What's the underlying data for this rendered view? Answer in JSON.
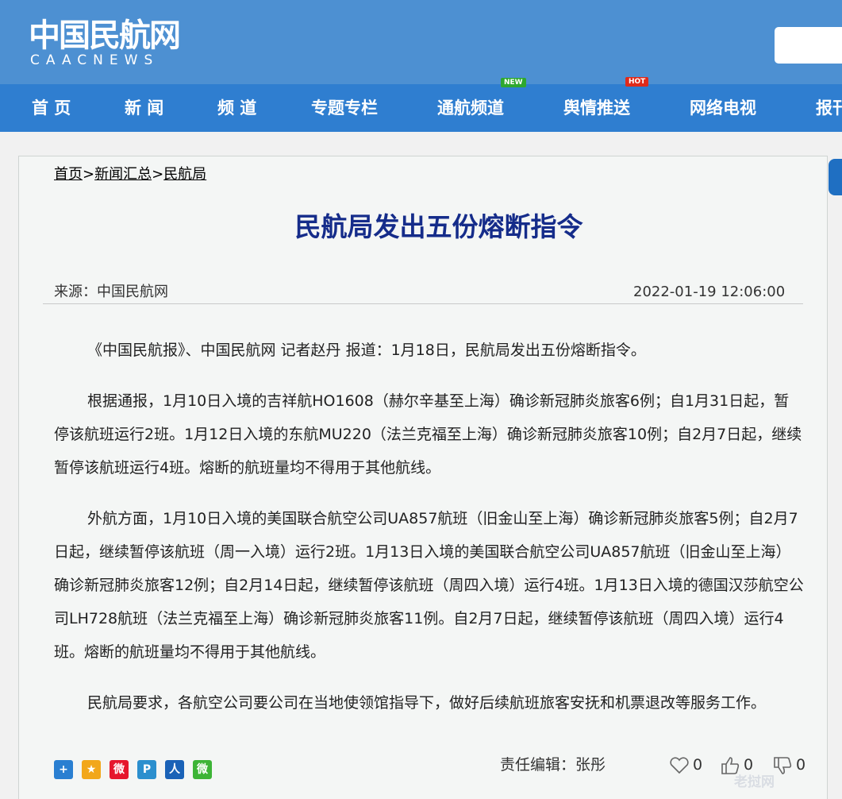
{
  "header": {
    "logo_cn": "中国民航网",
    "logo_en": "CAACNEWS"
  },
  "nav": {
    "items": [
      {
        "label": "首 页"
      },
      {
        "label": "新 闻"
      },
      {
        "label": "频 道"
      },
      {
        "label": "专题专栏"
      },
      {
        "label": "通航频道",
        "badge": "NEW"
      },
      {
        "label": "舆情推送",
        "badge": "HOT"
      },
      {
        "label": "网络电视"
      },
      {
        "label": "报刊"
      }
    ]
  },
  "breadcrumb": {
    "items": [
      "首页",
      "新闻汇总",
      "民航局"
    ],
    "separator": ">"
  },
  "article": {
    "title": "民航局发出五份熔断指令",
    "source": "来源：中国民航网",
    "datetime": "2022-01-19 12:06:00",
    "paragraphs": [
      "《中国民航报》、中国民航网 记者赵丹 报道：1月18日，民航局发出五份熔断指令。",
      "根据通报，1月10日入境的吉祥航HO1608（赫尔辛基至上海）确诊新冠肺炎旅客6例；自1月31日起，暂停该航班运行2班。1月12日入境的东航MU220（法兰克福至上海）确诊新冠肺炎旅客10例；自2月7日起，继续暂停该航班运行4班。熔断的航班量均不得用于其他航线。",
      "外航方面，1月10日入境的美国联合航空公司UA857航班（旧金山至上海）确诊新冠肺炎旅客5例；自2月7日起，继续暂停该航班（周一入境）运行2班。1月13日入境的美国联合航空公司UA857航班（旧金山至上海）确诊新冠肺炎旅客12例；自2月14日起，继续暂停该航班（周四入境）运行4班。1月13日入境的德国汉莎航空公司LH728航班（法兰克福至上海）确诊新冠肺炎旅客11例。自2月7日起，继续暂停该航班（周四入境）运行4班。熔断的航班量均不得用于其他航线。",
      "民航局要求，各航空公司要公司在当地使领馆指导下，做好后续航班旅客安抚和机票退改等服务工作。"
    ],
    "editor": "责任编辑：张彤"
  },
  "share": {
    "icons": [
      {
        "name": "more-share-icon",
        "glyph": "+",
        "color": "#2a7fd1"
      },
      {
        "name": "qzone-icon",
        "glyph": "★",
        "color": "#f2a71b"
      },
      {
        "name": "weibo-icon",
        "glyph": "微",
        "color": "#e6162d"
      },
      {
        "name": "tencent-weibo-icon",
        "glyph": "P",
        "color": "#2b8fce"
      },
      {
        "name": "renren-icon",
        "glyph": "人",
        "color": "#1a62b7"
      },
      {
        "name": "wechat-icon",
        "glyph": "微",
        "color": "#3db436"
      }
    ]
  },
  "reactions": {
    "like_count": "0",
    "thumbs_up_count": "0",
    "thumbs_down_count": "0"
  },
  "watermark": "老挝网",
  "colors": {
    "header_bg": "#4d90d2",
    "nav_bg": "#2f7ed0",
    "title": "#152c8a",
    "panel_bg": "#f4f6f5"
  }
}
